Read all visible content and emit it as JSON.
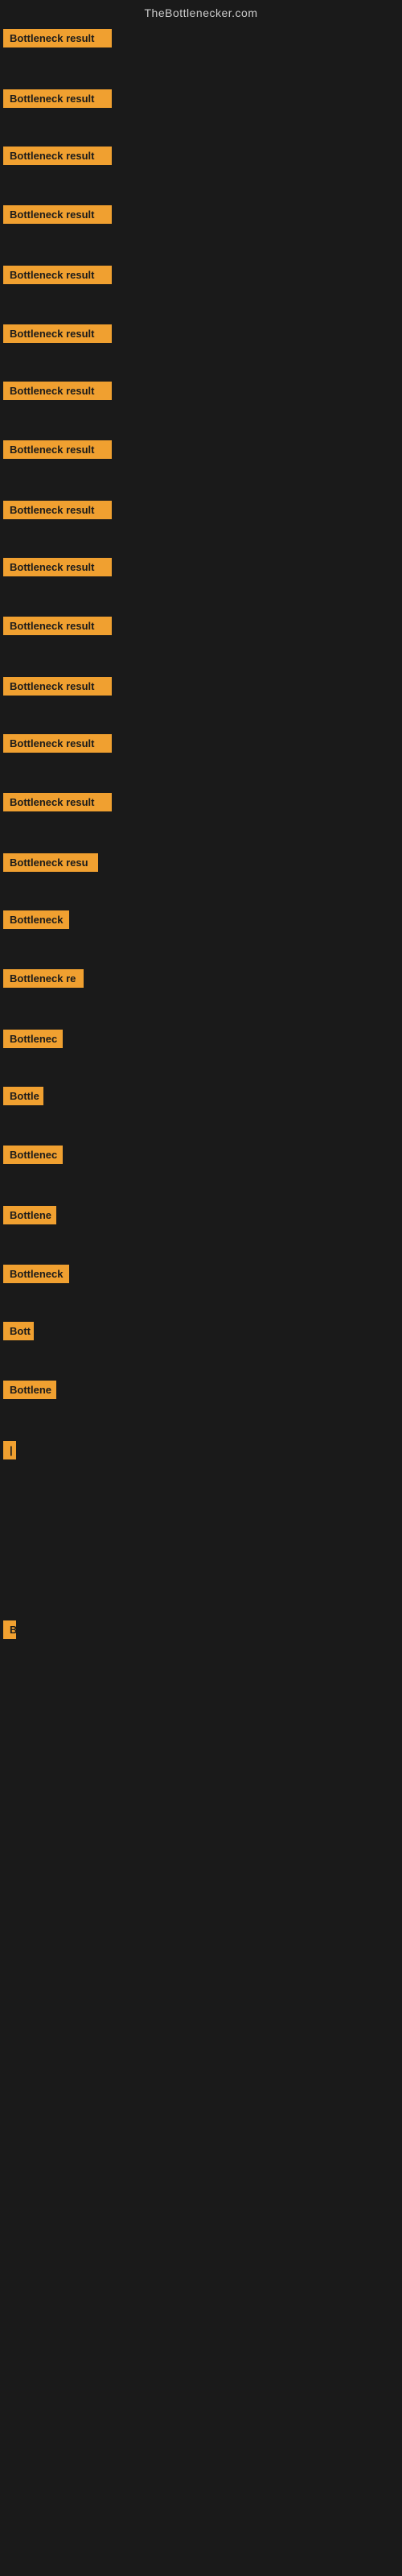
{
  "header": {
    "title": "TheBottlenecker.com"
  },
  "items": [
    {
      "label": "Bottleneck result",
      "width": 135
    },
    {
      "label": "Bottleneck result",
      "width": 135
    },
    {
      "label": "Bottleneck result",
      "width": 135
    },
    {
      "label": "Bottleneck result",
      "width": 135
    },
    {
      "label": "Bottleneck result",
      "width": 135
    },
    {
      "label": "Bottleneck result",
      "width": 135
    },
    {
      "label": "Bottleneck result",
      "width": 135
    },
    {
      "label": "Bottleneck result",
      "width": 135
    },
    {
      "label": "Bottleneck result",
      "width": 135
    },
    {
      "label": "Bottleneck result",
      "width": 135
    },
    {
      "label": "Bottleneck result",
      "width": 135
    },
    {
      "label": "Bottleneck result",
      "width": 135
    },
    {
      "label": "Bottleneck result",
      "width": 135
    },
    {
      "label": "Bottleneck result",
      "width": 135
    },
    {
      "label": "Bottleneck resu",
      "width": 118
    },
    {
      "label": "Bottleneck",
      "width": 82
    },
    {
      "label": "Bottleneck re",
      "width": 100
    },
    {
      "label": "Bottlenec",
      "width": 74
    },
    {
      "label": "Bottle",
      "width": 50
    },
    {
      "label": "Bottlenec",
      "width": 74
    },
    {
      "label": "Bottlene",
      "width": 66
    },
    {
      "label": "Bottleneck",
      "width": 82
    },
    {
      "label": "Bott",
      "width": 38
    },
    {
      "label": "Bottlene",
      "width": 66
    },
    {
      "label": "|",
      "width": 10
    },
    {
      "label": "",
      "width": 0
    },
    {
      "label": "B",
      "width": 14
    }
  ]
}
